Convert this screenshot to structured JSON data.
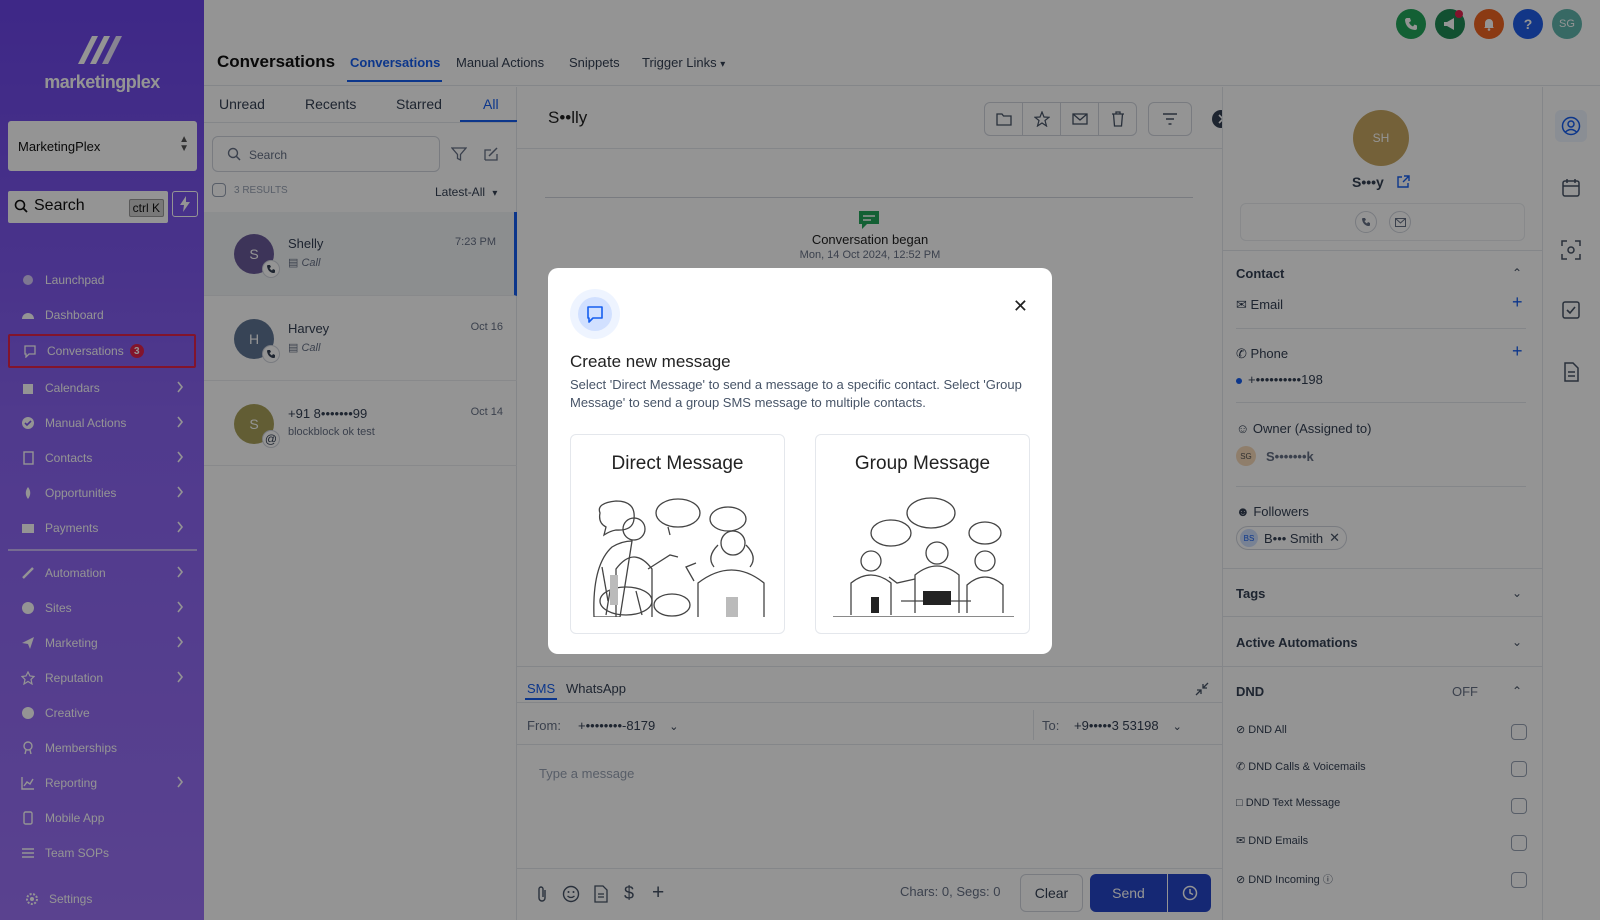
{
  "sidebar": {
    "brand": "marketingplex",
    "account": "MarketingPlex",
    "search_label": "Search",
    "search_shortcut": "ctrl K",
    "items": [
      {
        "label": "Launchpad",
        "icon": "rocket-icon"
      },
      {
        "label": "Dashboard",
        "icon": "gauge-icon"
      },
      {
        "label": "Conversations",
        "icon": "chat-icon",
        "badge": "3"
      },
      {
        "label": "Calendars",
        "icon": "calendar-icon"
      },
      {
        "label": "Manual Actions",
        "icon": "check-badge-icon"
      },
      {
        "label": "Contacts",
        "icon": "contacts-icon"
      },
      {
        "label": "Opportunities",
        "icon": "flame-icon"
      },
      {
        "label": "Payments",
        "icon": "card-icon"
      },
      {
        "label": "Automation",
        "icon": "wand-icon"
      },
      {
        "label": "Sites",
        "icon": "globe-icon"
      },
      {
        "label": "Marketing",
        "icon": "send-icon"
      },
      {
        "label": "Reputation",
        "icon": "star-icon"
      },
      {
        "label": "Creative",
        "icon": "palette-icon"
      },
      {
        "label": "Memberships",
        "icon": "award-icon"
      },
      {
        "label": "Reporting",
        "icon": "chart-icon"
      },
      {
        "label": "Mobile App",
        "icon": "phone-icon"
      },
      {
        "label": "Team SOPs",
        "icon": "list-icon"
      }
    ],
    "settings": "Settings"
  },
  "header": {
    "title": "Conversations",
    "tabs": [
      "Conversations",
      "Manual Actions",
      "Snippets",
      "Trigger Links"
    ],
    "user_initials": "SG",
    "help": "?"
  },
  "list": {
    "tabs": [
      "Unread",
      "Recents",
      "Starred",
      "All"
    ],
    "search_placeholder": "Search",
    "results": "3 RESULTS",
    "sort": "Latest-All",
    "conversations": [
      {
        "initial": "S",
        "name": "Shelly",
        "preview": "Call",
        "time": "7:23 PM"
      },
      {
        "initial": "H",
        "name": "Harvey",
        "preview": "Call",
        "time": "Oct 16"
      },
      {
        "initial": "S",
        "name": "+91 8•••••••99",
        "preview": "blockblock ok test",
        "time": "Oct 14"
      }
    ]
  },
  "thread": {
    "contact_name": "S••lly",
    "began_title": "Conversation began",
    "began_time": "Mon, 14 Oct 2024, 12:52 PM"
  },
  "composer": {
    "tabs": [
      "SMS",
      "WhatsApp"
    ],
    "from_label": "From:",
    "from_value": "+••••••••-8179",
    "to_label": "To:",
    "to_value": "+9•••••3 53198",
    "placeholder": "Type a message",
    "counter": "Chars: 0, Segs: 0",
    "clear": "Clear",
    "send": "Send"
  },
  "contact_panel": {
    "initials": "SH",
    "name": "S•••y",
    "contact_section": "Contact",
    "email_label": "Email",
    "phone_label": "Phone",
    "phone_value": "+••••••••••198",
    "owner_label": "Owner (Assigned to)",
    "owner_initials": "SG",
    "owner_name": "S•••••••k",
    "followers_label": "Followers",
    "follower_initials": "BS",
    "follower_name": "B••• Smith",
    "tags": "Tags",
    "active_automations": "Active Automations",
    "dnd": "DND",
    "dnd_status": "OFF",
    "dnd_items": [
      "DND All",
      "DND Calls & Voicemails",
      "DND Text Message",
      "DND Emails",
      "DND Incoming"
    ]
  },
  "modal": {
    "title": "Create new message",
    "description": "Select 'Direct Message' to send a message to a specific contact. Select 'Group Message' to send a group SMS message to multiple contacts.",
    "direct": "Direct Message",
    "group": "Group Message"
  },
  "colors": {
    "accent": "#155eef",
    "sidebar": "#7b55ef",
    "badge": "#e0244d",
    "send": "#2546c8"
  }
}
